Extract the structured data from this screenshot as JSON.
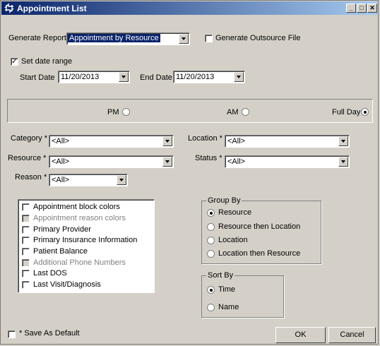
{
  "window": {
    "title": "Appointment List"
  },
  "report": {
    "generate_report_label": "Generate Report:",
    "generate_report_value": "Appointment by Resource",
    "outsource_label": "Generate Outsource File",
    "set_date_range_label": "Set date range",
    "start_date_label": "Start Date",
    "start_date_value": "11/20/2013",
    "end_date_label": "End Date",
    "end_date_value": "11/20/2013"
  },
  "time_of_day": {
    "pm": "PM",
    "am": "AM",
    "full_day": "Full Day"
  },
  "filters": {
    "category_label": "Category *",
    "category_value": "<All>",
    "location_label": "Location *",
    "location_value": "<All>",
    "resource_label": "Resource *",
    "resource_value": "<All>",
    "status_label": "Status *",
    "status_value": "<All>",
    "reason_label": "Reason *",
    "reason_value": "<All>"
  },
  "options": [
    {
      "label": "Appointment block colors",
      "enabled": true
    },
    {
      "label": "Appointment reason colors",
      "enabled": false
    },
    {
      "label": "Primary Provider",
      "enabled": true
    },
    {
      "label": "Primary Insurance Information",
      "enabled": true
    },
    {
      "label": "Patient Balance",
      "enabled": true
    },
    {
      "label": "Additional Phone Numbers",
      "enabled": false
    },
    {
      "label": "Last DOS",
      "enabled": true
    },
    {
      "label": "Last Visit/Diagnosis",
      "enabled": true
    }
  ],
  "group_by": {
    "title": "Group By",
    "items": [
      "Resource",
      "Resource then Location",
      "Location",
      "Location then Resource"
    ]
  },
  "sort_by": {
    "title": "Sort By",
    "items": [
      "Time",
      "Name"
    ]
  },
  "footer": {
    "save_default": "* Save As Default",
    "ok": "OK",
    "cancel": "Cancel"
  }
}
